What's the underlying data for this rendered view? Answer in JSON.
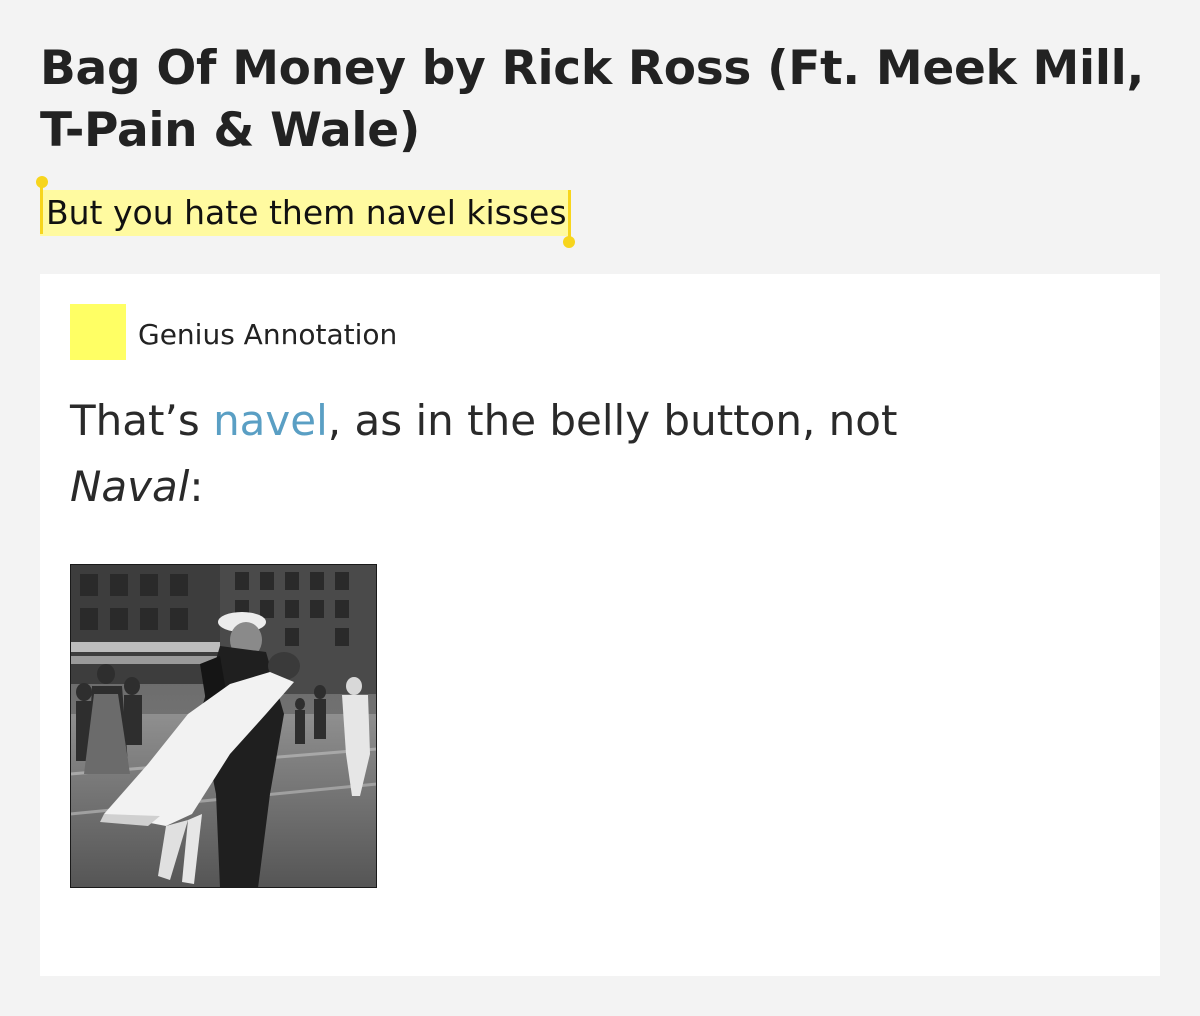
{
  "song": {
    "title": "Bag Of Money by Rick Ross (Ft. Meek Mill, T-Pain & Wale)"
  },
  "lyric": {
    "text": "But you hate them navel kisses"
  },
  "annotation": {
    "badge_label": "Genius Annotation",
    "body": {
      "text_before": "That’s ",
      "link_text": "navel",
      "text_middle": ", as in the belly button, not ",
      "italic_text": "Naval",
      "text_after": ":"
    },
    "image": {
      "icon": "photo-image"
    }
  },
  "colors": {
    "highlight": "#fffaa0",
    "handle": "#f7d51d",
    "badge": "#ffff64",
    "link": "#5a9fc4",
    "page_background": "#f3f3f3",
    "card_background": "#ffffff"
  }
}
